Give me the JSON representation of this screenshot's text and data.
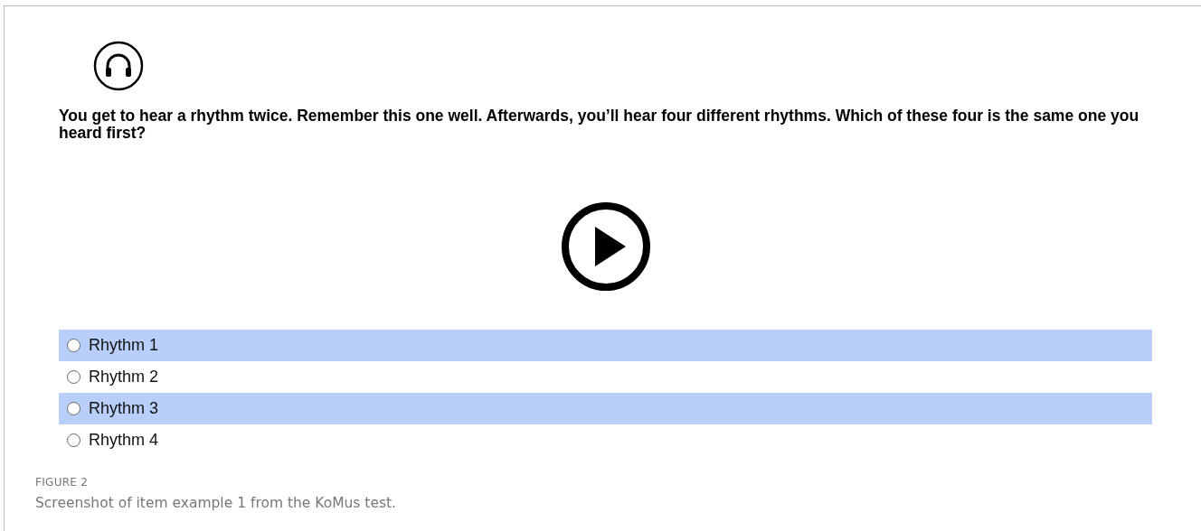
{
  "question": "You get to hear a rhythm twice. Remember this one well. Afterwards, you’ll hear four different rhythms. Which of these four is the same one you heard first?",
  "options": [
    {
      "label": "Rhythm 1",
      "selected": false,
      "shaded": true
    },
    {
      "label": "Rhythm 2",
      "selected": false,
      "shaded": false
    },
    {
      "label": "Rhythm 3",
      "selected": false,
      "shaded": true
    },
    {
      "label": "Rhythm 4",
      "selected": false,
      "shaded": false
    }
  ],
  "caption": {
    "label": "FIGURE 2",
    "text": "Screenshot of item example 1 from the KoMus test."
  }
}
